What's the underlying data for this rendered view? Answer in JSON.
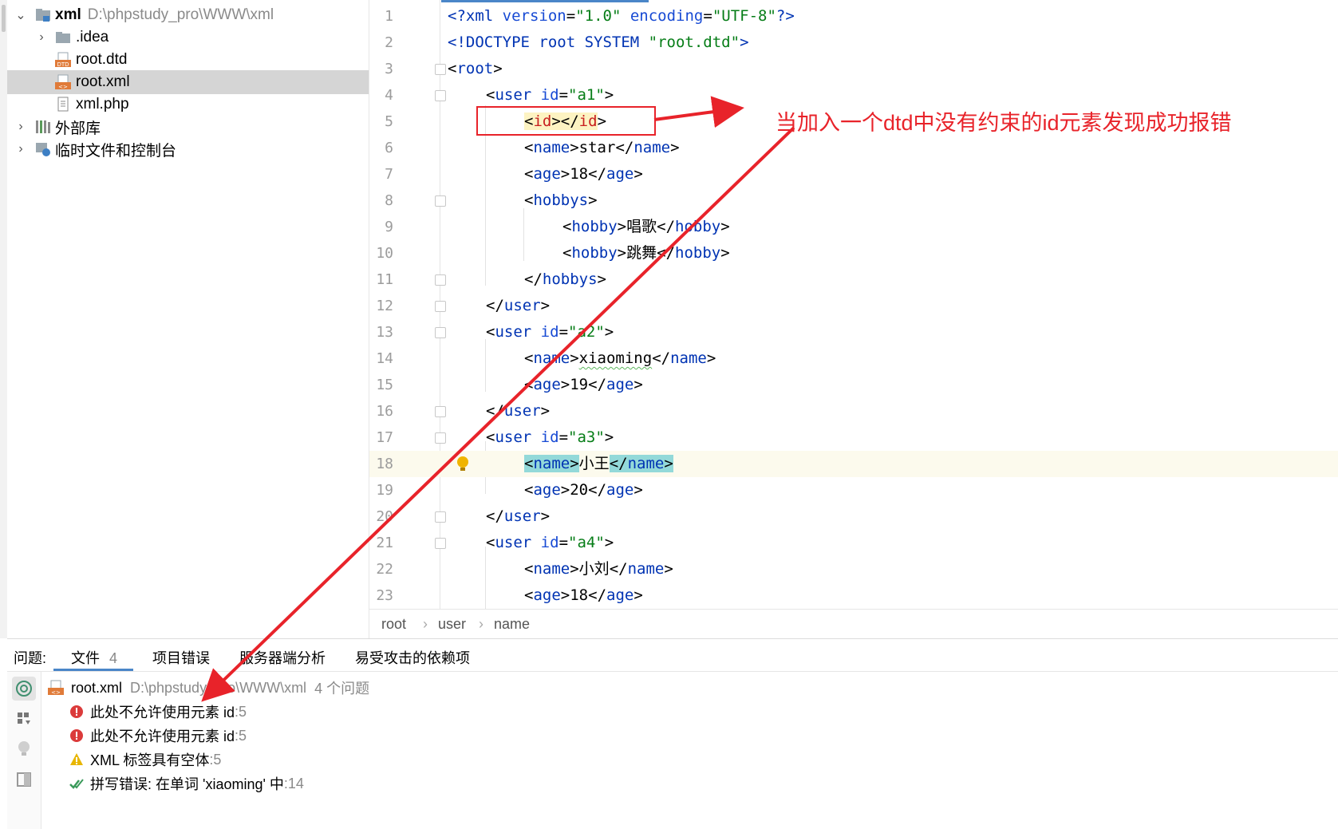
{
  "tree": {
    "root": {
      "label": "xml",
      "path": "D:\\phpstudy_pro\\WWW\\xml"
    },
    "items": [
      {
        "label": ".idea",
        "icon": "folder-icon"
      },
      {
        "label": "root.dtd",
        "icon": "dtd-file-icon"
      },
      {
        "label": "root.xml",
        "icon": "xml-file-icon",
        "selected": true
      },
      {
        "label": "xml.php",
        "icon": "php-file-icon"
      }
    ],
    "external_libs": "外部库",
    "scratches": "临时文件和控制台"
  },
  "editor": {
    "lines": [
      "1",
      "2",
      "3",
      "4",
      "5",
      "6",
      "7",
      "8",
      "9",
      "10",
      "11",
      "12",
      "13",
      "14",
      "15",
      "16",
      "17",
      "18",
      "19",
      "20",
      "21",
      "22",
      "23"
    ],
    "code": {
      "l1": {
        "open": "<?",
        "xml": "xml",
        "sp1": " ",
        "a1": "version",
        "eq1": "=",
        "v1": "\"1.0\"",
        "sp2": " ",
        "a2": "encoding",
        "eq2": "=",
        "v2": "\"UTF-8\"",
        "close": "?>"
      },
      "l2": {
        "doctype": "<!DOCTYPE root SYSTEM ",
        "dtd": "\"root.dtd\"",
        "close": ">"
      },
      "l3": {
        "t": "root"
      },
      "l4": {
        "t": "user",
        "a": "id",
        "v": "\"a1\""
      },
      "l5": {
        "t1": "id",
        "t2": "id"
      },
      "l6": {
        "t": "name",
        "text": "star"
      },
      "l7": {
        "t": "age",
        "text": "18"
      },
      "l8": {
        "t": "hobbys"
      },
      "l9": {
        "t": "hobby",
        "text": "唱歌"
      },
      "l10": {
        "t": "hobby",
        "text": "跳舞"
      },
      "l11": {
        "t": "hobbys"
      },
      "l12": {
        "t": "user"
      },
      "l13": {
        "t": "user",
        "a": "id",
        "v": "\"a2\""
      },
      "l14": {
        "t": "name",
        "text": "xiaoming"
      },
      "l15": {
        "t": "age",
        "text": "19"
      },
      "l16": {
        "t": "user"
      },
      "l17": {
        "t": "user",
        "a": "id",
        "v": "\"a3\""
      },
      "l18": {
        "t": "name",
        "text": "小王"
      },
      "l19": {
        "t": "age",
        "text": "20"
      },
      "l20": {
        "t": "user"
      },
      "l21": {
        "t": "user",
        "a": "id",
        "v": "\"a4\""
      },
      "l22": {
        "t": "name",
        "text": "小刘"
      },
      "l23": {
        "t": "age",
        "text": "18"
      }
    }
  },
  "breadcrumb": [
    "root",
    "user",
    "name"
  ],
  "problems": {
    "label": "问题:",
    "tabs": [
      {
        "label": "文件",
        "count": "4"
      },
      {
        "label": "项目错误"
      },
      {
        "label": "服务器端分析"
      },
      {
        "label": "易受攻击的依赖项"
      }
    ],
    "file": {
      "name": "root.xml",
      "path": "D:\\phpstudy_pro\\WWW\\xml",
      "summary": "4 个问题"
    },
    "items": [
      {
        "text": "此处不允许使用元素 id",
        "loc": ":5",
        "severity": "error"
      },
      {
        "text": "此处不允许使用元素 id",
        "loc": ":5",
        "severity": "error"
      },
      {
        "text": "XML 标签具有空体",
        "loc": ":5",
        "severity": "warning"
      },
      {
        "text": "拼写错误: 在单词 'xiaoming' 中",
        "loc": ":14",
        "severity": "typo"
      }
    ]
  },
  "annotation": {
    "text": "当加入一个dtd中没有约束的id元素发现成功报错",
    "color": "#e8232a"
  },
  "colors": {
    "tag": "#0033b3",
    "value": "#067d17",
    "selection": "#d5d5d5",
    "accent": "#4a86c8"
  }
}
